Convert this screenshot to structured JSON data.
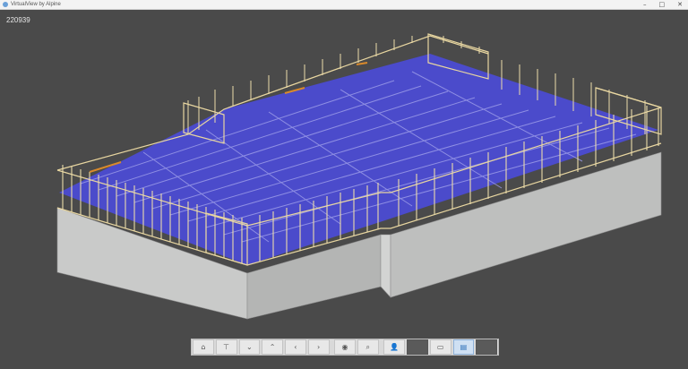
{
  "window": {
    "title": "VirtualView by Alpine",
    "controls": {
      "minimize": "–",
      "maximize": "□",
      "close": "✕"
    }
  },
  "model_id": "220939",
  "colors": {
    "background": "#4a4a4a",
    "floor": "#4b4bd6",
    "stud": "#e8d6a0",
    "foundation_side": "#c9cac9",
    "foundation_top": "#a8a9a8"
  },
  "toolbar": {
    "buttons": [
      {
        "name": "home-button",
        "icon": "home-icon",
        "glyph": "⌂"
      },
      {
        "name": "top-view-button",
        "icon": "top-view-icon",
        "glyph": "⊤"
      },
      {
        "name": "level-down-button",
        "icon": "chevron-down-icon",
        "glyph": "⌄"
      },
      {
        "name": "level-up-button",
        "icon": "chevron-up-icon",
        "glyph": "⌃"
      },
      {
        "name": "previous-button",
        "icon": "chevron-left-icon",
        "glyph": "‹"
      },
      {
        "name": "next-button",
        "icon": "chevron-right-icon",
        "glyph": "›"
      },
      {
        "name": "visibility-button",
        "icon": "eye-icon",
        "glyph": "◉"
      },
      {
        "name": "zoom-button",
        "icon": "magnifier-icon",
        "glyph": "⌕"
      },
      {
        "name": "user-button",
        "icon": "person-icon",
        "glyph": "👤"
      },
      {
        "name": "measure-button",
        "icon": "ruler-icon",
        "glyph": "▭"
      },
      {
        "name": "layers-button",
        "icon": "layers-icon",
        "glyph": "▤"
      }
    ]
  }
}
